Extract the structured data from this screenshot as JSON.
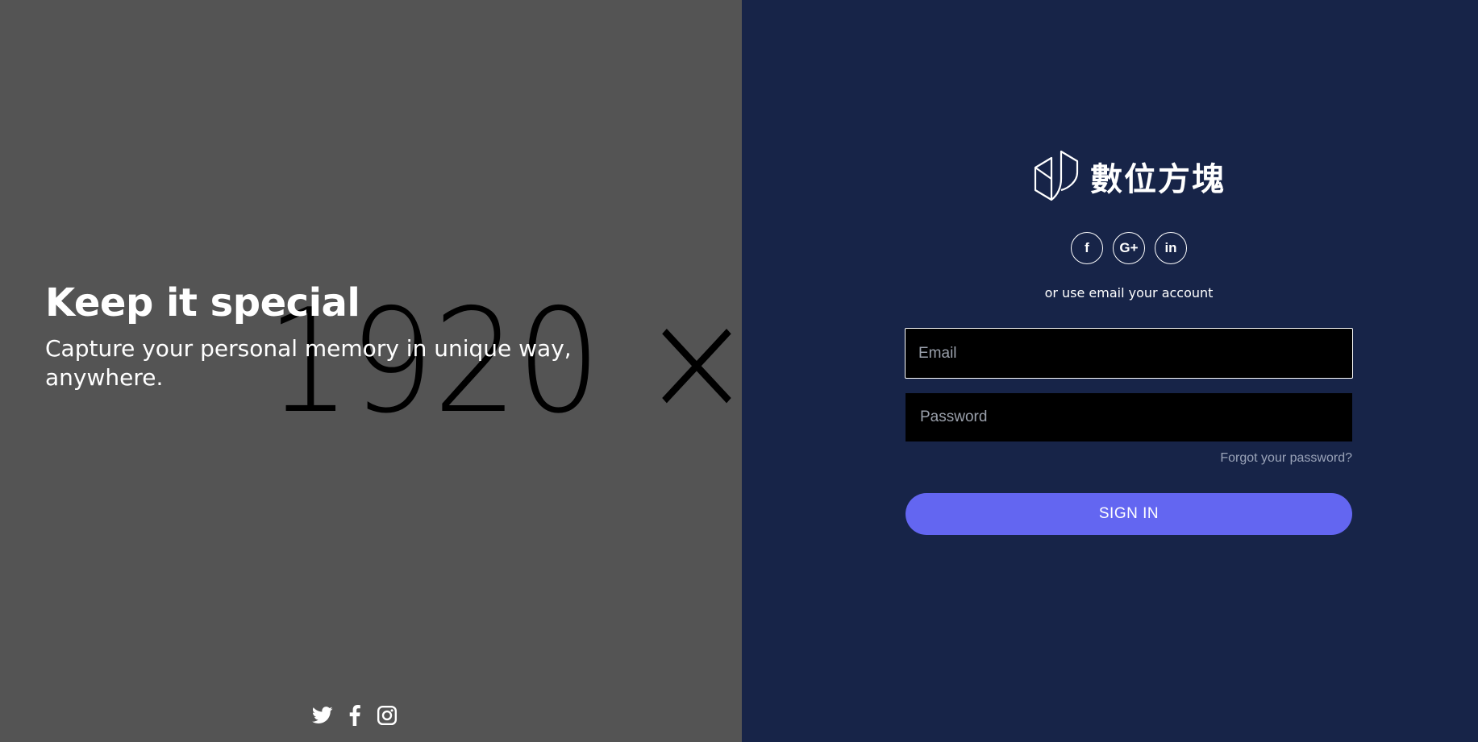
{
  "hero": {
    "placeholder_text": "1920 ×",
    "title": "Keep it special",
    "subtitle": "Capture your personal memory in unique way, anywhere.",
    "social_icons": [
      "twitter-icon",
      "facebook-icon",
      "instagram-icon"
    ]
  },
  "login": {
    "brand_name": "數位方塊",
    "social_buttons": {
      "facebook": "f",
      "google": "G+",
      "linkedin": "in"
    },
    "or_text": "or use email your account",
    "email_placeholder": "Email",
    "password_placeholder": "Password",
    "forgot_label": "Forgot your password?",
    "signin_label": "SIGN IN"
  },
  "colors": {
    "hero_bg": "#545454",
    "login_bg": "#172448",
    "accent": "#6366f1",
    "field_bg": "#000000"
  }
}
